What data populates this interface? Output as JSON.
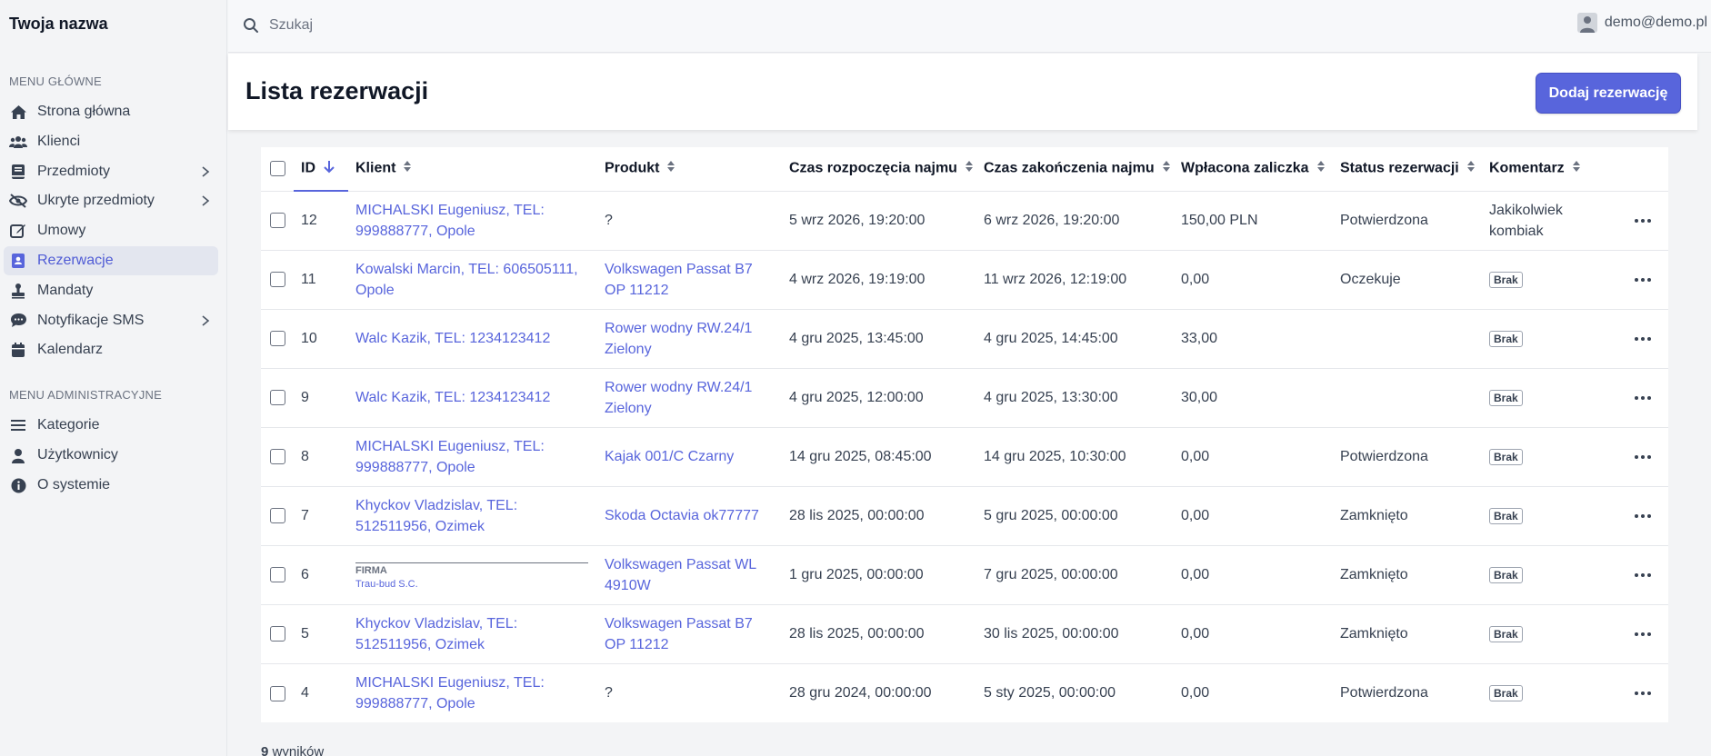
{
  "brand": "Twoja nazwa",
  "search": {
    "placeholder": "Szukaj"
  },
  "user": {
    "email": "demo@demo.pl"
  },
  "sidebar": {
    "main_label": "MENU GŁÓWNE",
    "main_items": [
      {
        "label": "Strona główna",
        "icon": "home-icon",
        "submenu": false,
        "active": false
      },
      {
        "label": "Klienci",
        "icon": "users-icon",
        "submenu": false,
        "active": false
      },
      {
        "label": "Przedmioty",
        "icon": "book-icon",
        "submenu": true,
        "active": false
      },
      {
        "label": "Ukryte przedmioty",
        "icon": "eye-slash-icon",
        "submenu": true,
        "active": false
      },
      {
        "label": "Umowy",
        "icon": "edit-icon",
        "submenu": false,
        "active": false
      },
      {
        "label": "Rezerwacje",
        "icon": "address-card-icon",
        "submenu": false,
        "active": true
      },
      {
        "label": "Mandaty",
        "icon": "stamp-icon",
        "submenu": false,
        "active": false
      },
      {
        "label": "Notyfikacje SMS",
        "icon": "sms-icon",
        "submenu": true,
        "active": false
      },
      {
        "label": "Kalendarz",
        "icon": "calendar-icon",
        "submenu": false,
        "active": false
      }
    ],
    "admin_label": "MENU ADMINISTRACYJNE",
    "admin_items": [
      {
        "label": "Kategorie",
        "icon": "list-icon"
      },
      {
        "label": "Użytkownicy",
        "icon": "user-icon"
      },
      {
        "label": "O systemie",
        "icon": "info-icon"
      }
    ]
  },
  "page": {
    "title": "Lista rezerwacji",
    "add_button": "Dodaj rezerwację"
  },
  "table": {
    "columns": {
      "id": "ID",
      "client": "Klient",
      "product": "Produkt",
      "start": "Czas rozpoczęcia najmu",
      "end": "Czas zakończenia najmu",
      "deposit": "Wpłacona zaliczka",
      "status": "Status rezerwacji",
      "comment": "Komentarz"
    },
    "rows": [
      {
        "id": "12",
        "client": "MICHALSKI Eugeniusz, TEL: 999888777, Opole",
        "product": "?",
        "product_link": false,
        "start": "5 wrz 2026, 19:20:00",
        "end": "6 wrz 2026, 19:20:00",
        "deposit": "150,00 PLN",
        "status": "Potwierdzona",
        "comment": "Jakikolwiek kombiak",
        "comment_badge": false
      },
      {
        "id": "11",
        "client": "Kowalski Marcin, TEL: 606505111, Opole",
        "product": "Volkswagen Passat B7 OP 11212",
        "product_link": true,
        "start": "4 wrz 2026, 19:19:00",
        "end": "11 wrz 2026, 12:19:00",
        "deposit": "0,00",
        "status": "Oczekuje",
        "comment": "Brak",
        "comment_badge": true
      },
      {
        "id": "10",
        "client": "Walc Kazik, TEL: 1234123412",
        "product": "Rower wodny RW.24/1 Zielony",
        "product_link": true,
        "start": "4 gru 2025, 13:45:00",
        "end": "4 gru 2025, 14:45:00",
        "deposit": "33,00",
        "status": "",
        "comment": "Brak",
        "comment_badge": true
      },
      {
        "id": "9",
        "client": "Walc Kazik, TEL: 1234123412",
        "product": "Rower wodny RW.24/1 Zielony",
        "product_link": true,
        "start": "4 gru 2025, 12:00:00",
        "end": "4 gru 2025, 13:30:00",
        "deposit": "30,00",
        "status": "",
        "comment": "Brak",
        "comment_badge": true
      },
      {
        "id": "8",
        "client": "MICHALSKI Eugeniusz, TEL: 999888777, Opole",
        "product": "Kajak 001/C Czarny",
        "product_link": true,
        "start": "14 gru 2025, 08:45:00",
        "end": "14 gru 2025, 10:30:00",
        "deposit": "0,00",
        "status": "Potwierdzona",
        "comment": "Brak",
        "comment_badge": true
      },
      {
        "id": "7",
        "client": "Khyckov Vladzislav, TEL: 512511956, Ozimek",
        "product": "Skoda Octavia ok77777",
        "product_link": true,
        "start": "28 lis 2025, 00:00:00",
        "end": "5 gru 2025, 00:00:00",
        "deposit": "0,00",
        "status": "Zamknięto",
        "comment": "Brak",
        "comment_badge": true
      },
      {
        "id": "6",
        "client_firma": true,
        "firma_label": "FIRMA",
        "client": "Trau-bud S.C.",
        "product": "Volkswagen Passat WL 4910W",
        "product_link": true,
        "start": "1 gru 2025, 00:00:00",
        "end": "7 gru 2025, 00:00:00",
        "deposit": "0,00",
        "status": "Zamknięto",
        "comment": "Brak",
        "comment_badge": true
      },
      {
        "id": "5",
        "client": "Khyckov Vladzislav, TEL: 512511956, Ozimek",
        "product": "Volkswagen Passat B7 OP 11212",
        "product_link": true,
        "start": "28 lis 2025, 00:00:00",
        "end": "30 lis 2025, 00:00:00",
        "deposit": "0,00",
        "status": "Zamknięto",
        "comment": "Brak",
        "comment_badge": true
      },
      {
        "id": "4",
        "client": "MICHALSKI Eugeniusz, TEL: 999888777, Opole",
        "product": "?",
        "product_link": false,
        "start": "28 gru 2024, 00:00:00",
        "end": "5 sty 2025, 00:00:00",
        "deposit": "0,00",
        "status": "Potwierdzona",
        "comment": "Brak",
        "comment_badge": true
      }
    ]
  },
  "footer": {
    "count_number": "9",
    "count_label": "wyników"
  }
}
